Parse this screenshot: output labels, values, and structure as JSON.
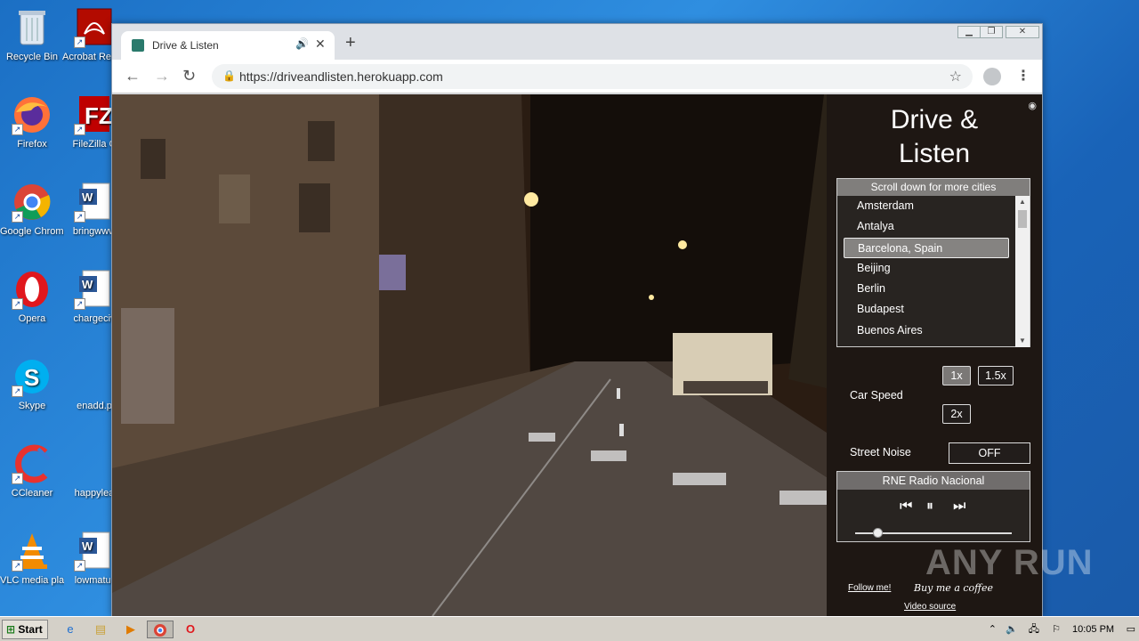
{
  "desktop": {
    "icons": [
      {
        "label": "Recycle Bin",
        "icon": "recycle-bin-icon"
      },
      {
        "label": "Acrobat Reader",
        "icon": "acrobat-icon"
      },
      {
        "label": "Firefox",
        "icon": "firefox-icon"
      },
      {
        "label": "FileZilla C",
        "icon": "filezilla-icon"
      },
      {
        "label": "Google Chrome",
        "icon": "chrome-icon"
      },
      {
        "label": "bringwww",
        "icon": "word-doc-icon"
      },
      {
        "label": "Opera",
        "icon": "opera-icon"
      },
      {
        "label": "chargeciv",
        "icon": "word-doc-icon"
      },
      {
        "label": "Skype",
        "icon": "skype-icon"
      },
      {
        "label": "enadd.p",
        "icon": "file-icon"
      },
      {
        "label": "CCleaner",
        "icon": "ccleaner-icon"
      },
      {
        "label": "happylea",
        "icon": "file-icon"
      },
      {
        "label": "VLC media player",
        "icon": "vlc-icon"
      },
      {
        "label": "lowmatur",
        "icon": "word-doc-icon"
      }
    ]
  },
  "browser": {
    "tab_title": "Drive & Listen",
    "url": "https://driveandlisten.herokuapp.com",
    "icons": {
      "back": "←",
      "forward": "→",
      "reload": "↻",
      "star": "☆",
      "menu": "⋮",
      "close": "✕",
      "new_tab": "+",
      "speaker": "🔊",
      "lock": "🔒"
    }
  },
  "app": {
    "title_line1": "Drive &",
    "title_line2": "Listen",
    "city_header": "Scroll down for more cities",
    "cities": [
      "Amsterdam",
      "Antalya",
      "Barcelona, Spain",
      "Beijing",
      "Berlin",
      "Budapest",
      "Buenos Aires"
    ],
    "selected_city": "Barcelona, Spain",
    "car_speed_label": "Car Speed",
    "speeds": [
      "1x",
      "1.5x",
      "2x"
    ],
    "active_speed": "1x",
    "street_noise_label": "Street Noise",
    "street_noise_value": "OFF",
    "radio_station": "RNE Radio Nacional",
    "volume": 0.14,
    "follow_link": "Follow me!",
    "coffee_link": "Buy me a coffee",
    "video_source_link": "Video source"
  },
  "taskbar": {
    "start_label": "Start",
    "clock": "10:05 PM"
  },
  "watermark": "ANY RUN"
}
